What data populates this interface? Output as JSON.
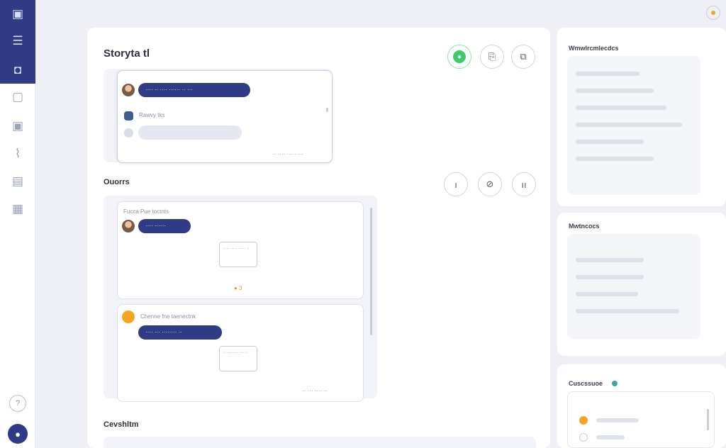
{
  "rail": {
    "items": [
      {
        "name": "app-logo-icon",
        "glyph": "▣"
      },
      {
        "name": "menu-icon",
        "glyph": "☰"
      },
      {
        "name": "chat-active-icon",
        "glyph": "◘"
      },
      {
        "name": "message-icon",
        "glyph": "▢"
      },
      {
        "name": "comment-icon",
        "glyph": "▣"
      },
      {
        "name": "attachment-icon",
        "glyph": "⌇"
      },
      {
        "name": "table-icon",
        "glyph": "▤"
      },
      {
        "name": "calendar-icon",
        "glyph": "▦"
      }
    ],
    "help_glyph": "?",
    "avatar_glyph": "●"
  },
  "main": {
    "section1": {
      "title": "Storyta tl",
      "actions": [
        "●",
        "⎘",
        "⧉"
      ],
      "card": {
        "bubble_text": "···· ·· ···· ······ ·· ···",
        "sub_text": "Rawvy tks",
        "footer": "·· ···· ····· ···"
      }
    },
    "section2": {
      "title": "Ouorrs",
      "actions": [
        "ı",
        "⊘",
        "ıı"
      ],
      "messages": [
        {
          "meta": "Fucca Pue toctnts",
          "bubble": "···· ······",
          "attach": "···· ···· ····· ·",
          "reaction": "● 3"
        },
        {
          "meta": "Chenne fne taenectnk",
          "bubble": "···· ··· ········ ··",
          "attach": "·········· ·····"
        }
      ],
      "footer": "·· ··· ···· ··"
    },
    "section3": {
      "title": "Cevshltm"
    }
  },
  "side": {
    "card1": {
      "title": "Wmwlrcmlecdcs",
      "lines": [
        "········",
        "··········· ··",
        "······ ·········",
        "··· ··········",
        "·······",
        "··········"
      ]
    },
    "card2": {
      "title": "Mwtncocs",
      "lines": [
        "··········",
        "··········",
        "·······",
        "···········"
      ]
    },
    "card3": {
      "title": "Cuscssuoe"
    }
  },
  "colors": {
    "accent": "#2f3b85",
    "success": "#3ecb6b",
    "warning": "#f5a524"
  }
}
